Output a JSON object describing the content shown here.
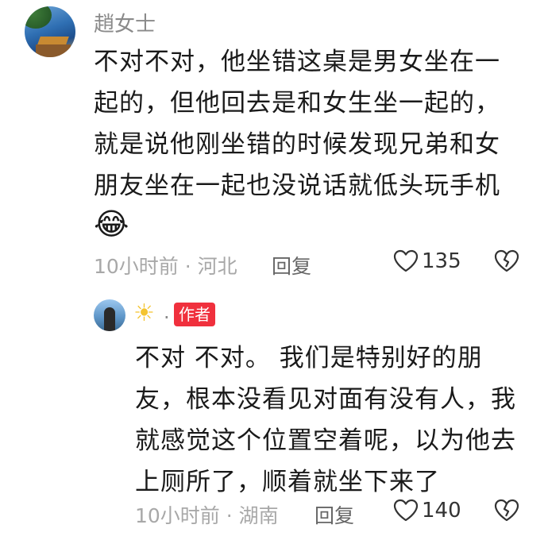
{
  "comments": [
    {
      "user": "趙女士",
      "lines": [
        "不对不对，他坐错这桌是男女坐在一",
        "起的，但他回去是和女生坐一起的，",
        "就是说他刚坐错的时候发现兄弟和女",
        "朋友坐在一起也没说话就低头玩手机"
      ],
      "emoji": "😂",
      "time": "10小时前",
      "location": "河北",
      "reply_label": "回复",
      "likes": "135",
      "avatar_icon": "landscape-avatar"
    }
  ],
  "reply": {
    "user_icon": "sun-icon",
    "user_suffix": ".",
    "badge": "作者",
    "badge_color": "#f0303d",
    "lines": [
      "不对   不对。 我们是特别好的朋",
      "友，根本没看见对面有没有人，我",
      "就感觉这个位置空着呢，以为他去",
      "上厕所了，顺着就坐下来了"
    ],
    "time": "10小时前",
    "location": "湖南",
    "reply_label": "回复",
    "likes": "140"
  },
  "separator": " · "
}
